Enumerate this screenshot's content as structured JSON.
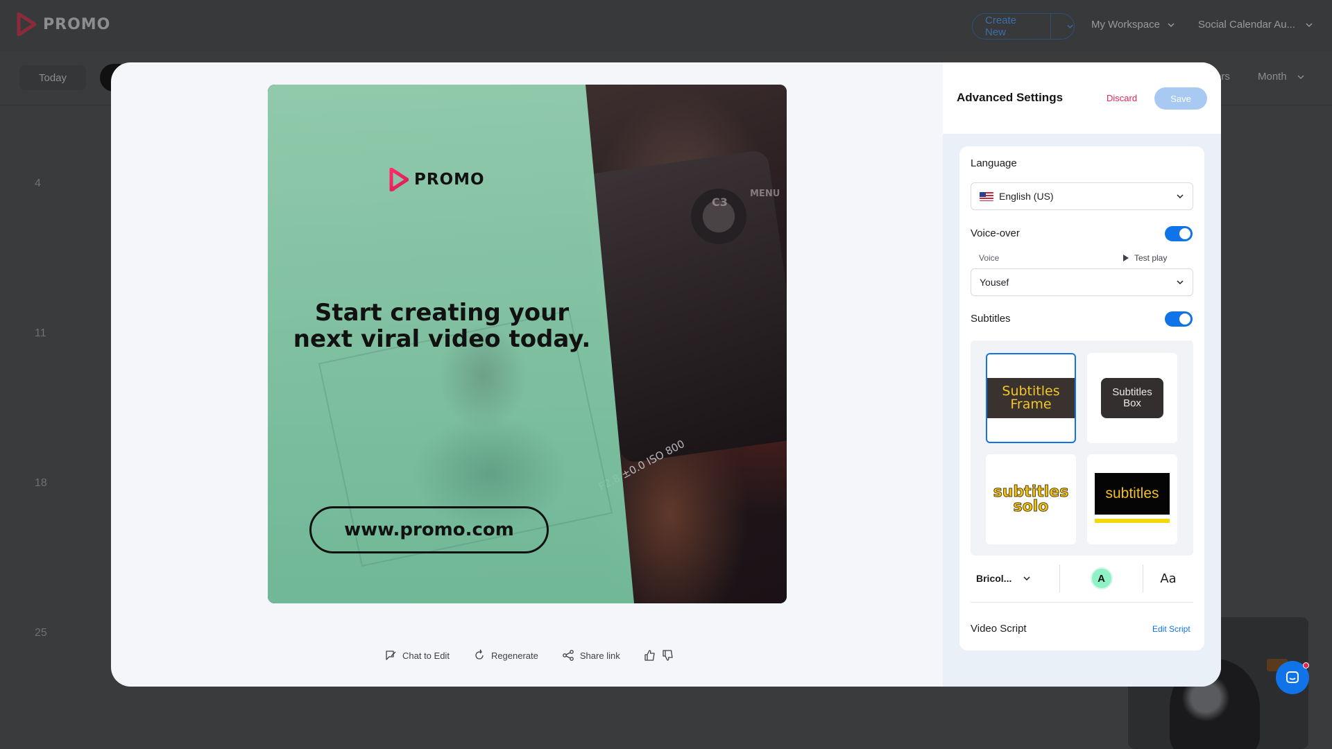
{
  "app": {
    "brand": "PROMO",
    "top_nav": {
      "create_new": "Create New",
      "workspace": "My Workspace",
      "calendar": "Social Calendar Au..."
    },
    "toolbar": {
      "today": "Today",
      "filters": "ers",
      "month": "Month"
    },
    "calendar_days": [
      "4",
      "11",
      "18",
      "25"
    ]
  },
  "preview": {
    "logo_text": "PROMO",
    "headline": "Start creating your next viral video today.",
    "url": "www.promo.com",
    "camera_text": {
      "c3": "C3",
      "menu": "MENU",
      "readout": "F2.8  ±0.0  ISO 800"
    },
    "actions": {
      "chat": "Chat to Edit",
      "regenerate": "Regenerate",
      "share": "Share link"
    }
  },
  "settings": {
    "title": "Advanced Settings",
    "discard": "Discard",
    "save": "Save",
    "language": {
      "label": "Language",
      "value": "English (US)"
    },
    "voiceover": {
      "label": "Voice-over",
      "enabled": true,
      "voice_label": "Voice",
      "test_play": "Test play",
      "voice_value": "Yousef"
    },
    "subtitles": {
      "label": "Subtitles",
      "enabled": true,
      "styles": [
        {
          "l1": "Subtitles",
          "l2": "Frame",
          "selected": true
        },
        {
          "l1": "Subtitles",
          "l2": "Box",
          "selected": false
        },
        {
          "l1": "subtitles",
          "l2": "solo",
          "selected": false
        },
        {
          "l1": "subtitles",
          "selected": false
        }
      ],
      "font": "Bricol...",
      "color_letter": "A",
      "case_glyph": "Aa"
    },
    "script": {
      "label": "Video Script",
      "edit": "Edit Script"
    }
  },
  "colors": {
    "accent": "#1173e8",
    "brand_pink": "#e3245c",
    "panel_green": "#8fd1b0",
    "subtitle_yellow": "#f4c527"
  }
}
